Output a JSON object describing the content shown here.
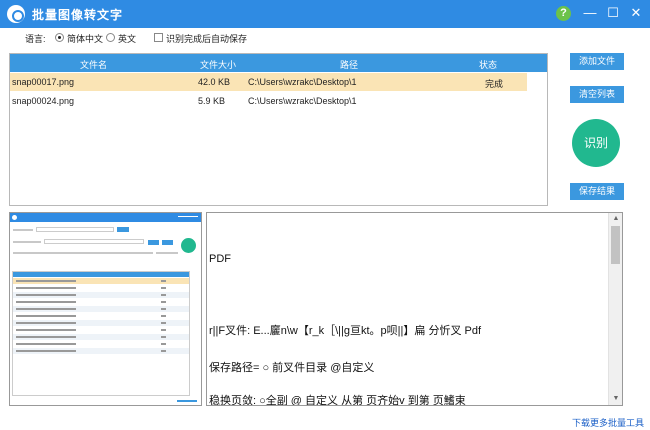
{
  "window": {
    "title": "批量图像转文字",
    "help": "?",
    "minimize": "—",
    "maximize": "☐",
    "close": "✕"
  },
  "options": {
    "language_label": "语言:",
    "languages": [
      {
        "label": "简体中文",
        "selected": true
      },
      {
        "label": "英文",
        "selected": false
      }
    ],
    "autosave_label": "识别完成后自动保存",
    "autosave_checked": false
  },
  "table": {
    "headers": [
      "文件名",
      "文件大小",
      "路径",
      "状态"
    ],
    "rows": [
      {
        "name": "snap00017.png",
        "size": "42.0 KB",
        "path": "C:\\Users\\wzrakc\\Desktop\\1",
        "status": "完成",
        "selected": true
      },
      {
        "name": "snap00024.png",
        "size": "5.9 KB",
        "path": "C:\\Users\\wzrakc\\Desktop\\1",
        "status": "",
        "selected": false
      }
    ]
  },
  "buttons": {
    "add_files": "添加文件",
    "clear_list": "清空列表",
    "recognize": "识别",
    "save_results": "保存结果"
  },
  "ocr_result": {
    "lines": [
      "PDF",
      "r||F叉件: E...廲n\\w【r_k［\\||g亘kt。p呗||】扁 分忻叉 Pdf",
      "保存路径= ○ 前叉件目录 @自定义",
      "稳换页敛: ○全副 @ 自定义 从第 页齐始v 到第 页鰭束"
    ]
  },
  "footer": {
    "more_tools": "下载更多批量工具"
  },
  "colors": {
    "titlebar": "#2f8be3",
    "header_blue": "#3b98df",
    "recognize_green": "#21b88f",
    "selected_row": "#fae4b5",
    "link": "#1a5fc7"
  },
  "icons": {
    "app": "app-logo-icon",
    "help": "help-icon",
    "minimize": "minimize-icon",
    "maximize": "maximize-icon",
    "close": "close-icon"
  }
}
